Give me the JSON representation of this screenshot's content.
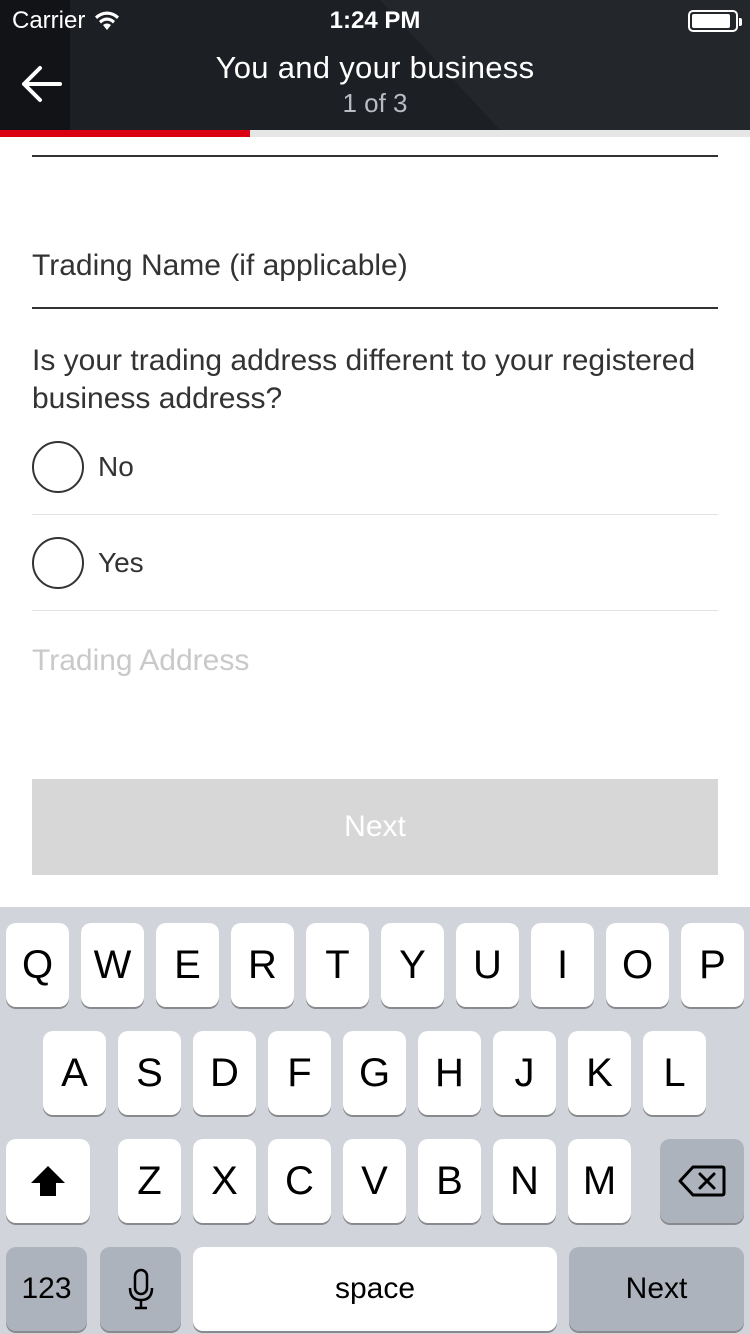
{
  "status_bar": {
    "carrier": "Carrier",
    "time": "1:24 PM"
  },
  "header": {
    "title": "You and your business",
    "step": "1 of 3",
    "progress_fraction": 0.333,
    "accent_color": "#db0011"
  },
  "form": {
    "trading_name_label": "Trading Name (if applicable)",
    "question": "Is your trading address different to your registered business address?",
    "options": [
      "No",
      "Yes"
    ],
    "trading_address_placeholder": "Trading Address",
    "next_label": "Next"
  },
  "keyboard": {
    "row1": [
      "Q",
      "W",
      "E",
      "R",
      "T",
      "Y",
      "U",
      "I",
      "O",
      "P"
    ],
    "row2": [
      "A",
      "S",
      "D",
      "F",
      "G",
      "H",
      "J",
      "K",
      "L"
    ],
    "row3": [
      "Z",
      "X",
      "C",
      "V",
      "B",
      "N",
      "M"
    ],
    "numbers_label": "123",
    "space_label": "space",
    "return_label": "Next"
  }
}
